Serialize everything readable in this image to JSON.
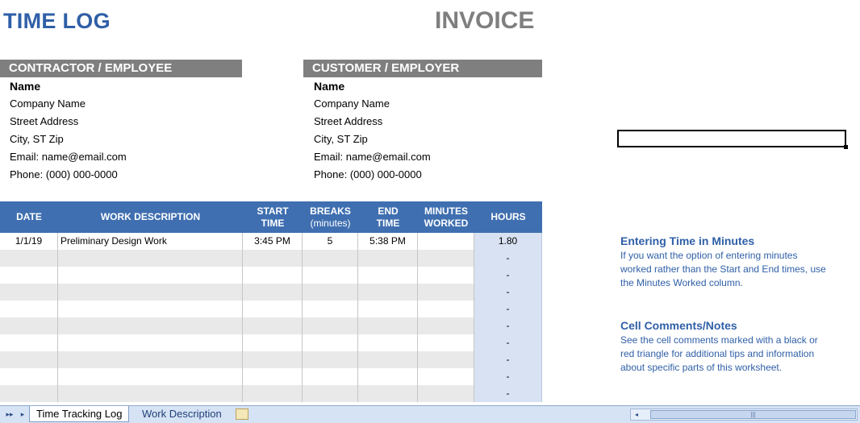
{
  "header": {
    "title_left": "TIME LOG",
    "title_right": "INVOICE"
  },
  "contractor": {
    "heading": "CONTRACTOR / EMPLOYEE",
    "name": "Name",
    "company": "Company Name",
    "street": "Street Address",
    "city": "City, ST Zip",
    "email": "Email: name@email.com",
    "phone": "Phone: (000) 000-0000"
  },
  "customer": {
    "heading": "CUSTOMER / EMPLOYER",
    "name": "Name",
    "company": "Company Name",
    "street": "Street Address",
    "city": "City, ST Zip",
    "email": "Email: name@email.com",
    "phone": "Phone: (000) 000-0000"
  },
  "table": {
    "headers": {
      "date": "DATE",
      "desc": "WORK DESCRIPTION",
      "start_1": "START",
      "start_2": "TIME",
      "breaks_1": "BREAKS",
      "breaks_2": "(minutes)",
      "end_1": "END",
      "end_2": "TIME",
      "minutes_1": "MINUTES",
      "minutes_2": "WORKED",
      "hours": "HOURS"
    },
    "rows": [
      {
        "date": "1/1/19",
        "desc": "Preliminary Design Work",
        "start": "3:45 PM",
        "breaks": "5",
        "end": "5:38 PM",
        "minutes": "",
        "hours": "1.80"
      },
      {
        "date": "",
        "desc": "",
        "start": "",
        "breaks": "",
        "end": "",
        "minutes": "",
        "hours": "-"
      },
      {
        "date": "",
        "desc": "",
        "start": "",
        "breaks": "",
        "end": "",
        "minutes": "",
        "hours": "-"
      },
      {
        "date": "",
        "desc": "",
        "start": "",
        "breaks": "",
        "end": "",
        "minutes": "",
        "hours": "-"
      },
      {
        "date": "",
        "desc": "",
        "start": "",
        "breaks": "",
        "end": "",
        "minutes": "",
        "hours": "-"
      },
      {
        "date": "",
        "desc": "",
        "start": "",
        "breaks": "",
        "end": "",
        "minutes": "",
        "hours": "-"
      },
      {
        "date": "",
        "desc": "",
        "start": "",
        "breaks": "",
        "end": "",
        "minutes": "",
        "hours": "-"
      },
      {
        "date": "",
        "desc": "",
        "start": "",
        "breaks": "",
        "end": "",
        "minutes": "",
        "hours": "-"
      },
      {
        "date": "",
        "desc": "",
        "start": "",
        "breaks": "",
        "end": "",
        "minutes": "",
        "hours": "-"
      },
      {
        "date": "",
        "desc": "",
        "start": "",
        "breaks": "",
        "end": "",
        "minutes": "",
        "hours": "-"
      }
    ]
  },
  "notes": {
    "note1_title": "Entering Time in Minutes",
    "note1_line1": "If you want the option of entering minutes",
    "note1_line2": "worked rather than the Start and End times, use",
    "note1_line3": "the Minutes Worked column.",
    "note2_title": "Cell Comments/Notes",
    "note2_line1": "See the cell comments marked with a black or",
    "note2_line2": "red triangle for additional tips and information",
    "note2_line3": "about specific parts of this worksheet."
  },
  "sheet_tabs": {
    "tab1": "Time Tracking Log",
    "tab2": "Work Description",
    "nav_first": "▸▸",
    "nav_prev": "▸"
  },
  "colors": {
    "accent": "#2f5fa7",
    "header_bg": "#3f6fb0",
    "section_bg": "#7f7f7f",
    "hours_col": "#d8e2f2"
  }
}
